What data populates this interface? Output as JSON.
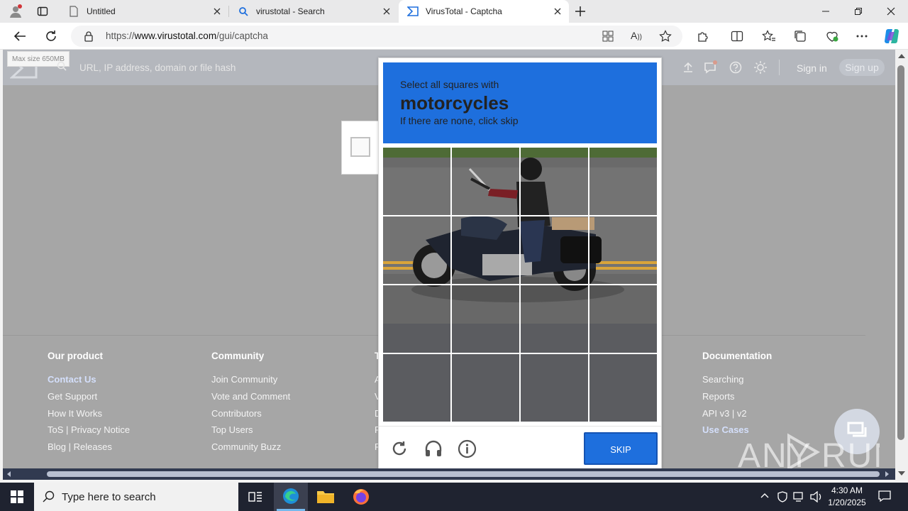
{
  "browser": {
    "tabs": [
      {
        "title": "Untitled",
        "icon": "page-icon"
      },
      {
        "title": "virustotal - Search",
        "icon": "search-icon"
      },
      {
        "title": "VirusTotal - Captcha",
        "icon": "virustotal-logo-icon"
      }
    ],
    "new_tab_icon": "plus-icon",
    "url": "https://www.virustotal.com/gui/captcha",
    "url_prefix": "https://",
    "url_host": "www.virustotal.com",
    "url_path": "/gui/captcha"
  },
  "vt_header": {
    "search_placeholder": "URL, IP address, domain or file hash",
    "tooltip": "Max size 650MB",
    "sign_in": "Sign in",
    "sign_up": "Sign up"
  },
  "footer": {
    "columns": [
      {
        "heading": "Our product",
        "links": [
          "Contact Us",
          "Get Support",
          "How It Works",
          "ToS | Privacy Notice",
          "Blog | Releases"
        ]
      },
      {
        "heading": "Community",
        "links": [
          "Join Community",
          "Vote and Comment",
          "Contributors",
          "Top Users",
          "Community Buzz"
        ]
      },
      {
        "heading": "Documentation",
        "links": [
          "Searching",
          "Reports",
          "API v3 | v2",
          "Use Cases"
        ]
      }
    ],
    "partial_letters": {
      "heading": "T",
      "links": [
        "A",
        "V",
        "D",
        "F",
        "F"
      ]
    }
  },
  "captcha": {
    "prompt_line1": "Select all squares with",
    "target": "motorcycles",
    "prompt_line3": "If there are none, click skip",
    "skip_label": "SKIP",
    "grid_rows": 4,
    "grid_cols": 4
  },
  "watermark": "ANY RUN",
  "taskbar": {
    "search_placeholder": "Type here to search",
    "time": "4:30 AM",
    "date": "1/20/2025"
  },
  "colors": {
    "captcha_blue": "#1e6fdd",
    "page_overlay": "#a6a6a6",
    "taskbar": "#1f2330"
  }
}
